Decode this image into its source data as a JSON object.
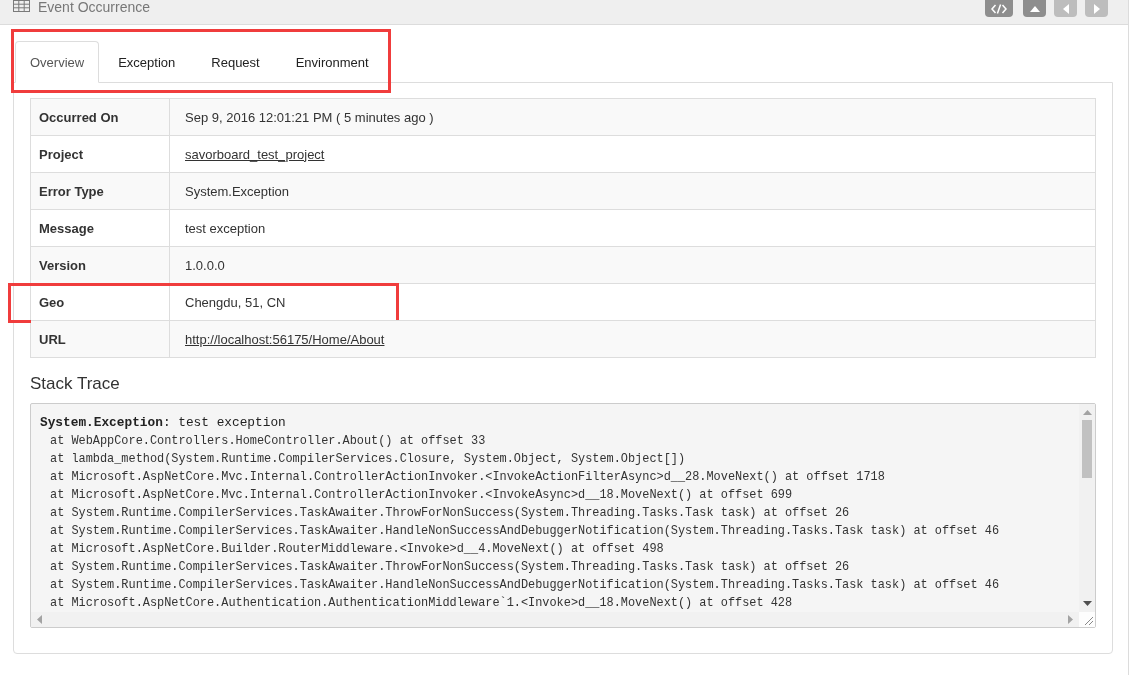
{
  "header": {
    "title": "Event Occurrence",
    "buttons": [
      {
        "kind": "code",
        "disabled": false
      },
      {
        "kind": "up",
        "disabled": false
      },
      {
        "kind": "prev",
        "disabled": true
      },
      {
        "kind": "next",
        "disabled": true
      }
    ]
  },
  "tab_bar": {
    "highlighted": true,
    "tabs": [
      {
        "label": "Overview",
        "selected": true
      },
      {
        "label": "Exception",
        "selected": false
      },
      {
        "label": "Request",
        "selected": false
      },
      {
        "label": "Environment",
        "selected": false
      }
    ]
  },
  "rows": [
    {
      "label": "Occurred On",
      "value": "Sep 9, 2016 12:01:21 PM ( 5 minutes ago )",
      "kind": "text",
      "highlighted": false
    },
    {
      "label": "Project",
      "value": "savorboard_test_project",
      "kind": "link",
      "highlighted": false
    },
    {
      "label": "Error Type",
      "value": "System.Exception",
      "kind": "text",
      "highlighted": false
    },
    {
      "label": "Message",
      "value": "test exception",
      "kind": "text",
      "highlighted": false
    },
    {
      "label": "Version",
      "value": "1.0.0.0",
      "kind": "text",
      "highlighted": false
    },
    {
      "label": "Geo",
      "value": "Chengdu, 51, CN",
      "kind": "text",
      "highlighted": true
    },
    {
      "label": "URL",
      "value": "http://localhost:56175/Home/About",
      "kind": "link",
      "highlighted": false
    }
  ],
  "stack_trace": {
    "title": "Stack Trace",
    "header": "**System.Exception**: test exception",
    "frames": [
      "at WebAppCore.Controllers.HomeController.About() at offset 33",
      "at lambda_method(System.Runtime.CompilerServices.Closure, System.Object, System.Object[])",
      "at Microsoft.AspNetCore.Mvc.Internal.ControllerActionInvoker.<InvokeActionFilterAsync>d__28.MoveNext() at offset 1718",
      "at Microsoft.AspNetCore.Mvc.Internal.ControllerActionInvoker.<InvokeAsync>d__18.MoveNext() at offset 699",
      "at System.Runtime.CompilerServices.TaskAwaiter.ThrowForNonSuccess(System.Threading.Tasks.Task task) at offset 26",
      "at System.Runtime.CompilerServices.TaskAwaiter.HandleNonSuccessAndDebuggerNotification(System.Threading.Tasks.Task task) at offset 46",
      "at Microsoft.AspNetCore.Builder.RouterMiddleware.<Invoke>d__4.MoveNext() at offset 498",
      "at System.Runtime.CompilerServices.TaskAwaiter.ThrowForNonSuccess(System.Threading.Tasks.Task task) at offset 26",
      "at System.Runtime.CompilerServices.TaskAwaiter.HandleNonSuccessAndDebuggerNotification(System.Threading.Tasks.Task task) at offset 46",
      "at Microsoft.AspNetCore.Authentication.AuthenticationMiddleware`1.<Invoke>d__18.MoveNext() at offset 428"
    ]
  }
}
